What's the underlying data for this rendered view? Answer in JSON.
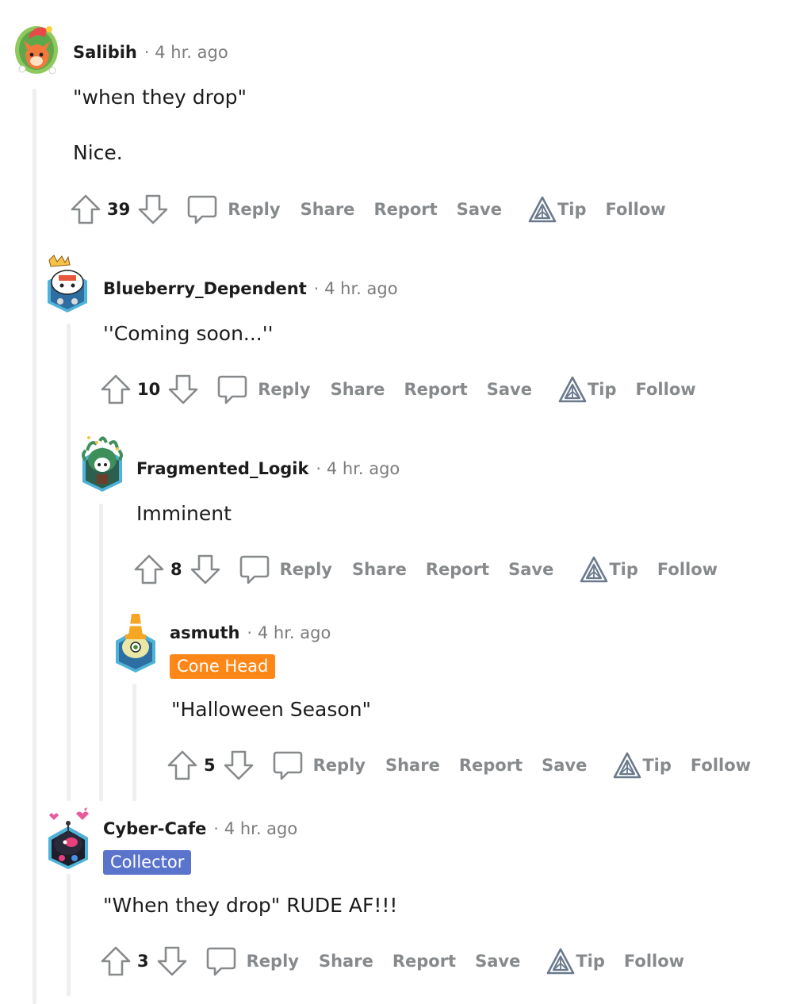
{
  "colors": {
    "thread_line": "#edeff1",
    "meta_gray": "#7c7c7c",
    "action_gray": "#878a8c",
    "cone_head_flair": "#ff8717",
    "collector_flair": "#5a74cc"
  },
  "icons": {
    "upvote": "arrow-up-outline-icon",
    "downvote": "arrow-down-outline-icon",
    "reply": "speech-bubble-icon",
    "tip": "triangle-tip-icon"
  },
  "comments": [
    {
      "username": "Salibih",
      "separator": "·",
      "time": "4 hr. ago",
      "flair": "",
      "body": [
        "\"when they drop\"",
        "Nice."
      ],
      "score": "39",
      "actions": {
        "reply": "Reply",
        "share": "Share",
        "report": "Report",
        "save": "Save",
        "tip": "Tip",
        "follow": "Follow"
      }
    },
    {
      "username": "Blueberry_Dependent",
      "separator": "·",
      "time": "4 hr. ago",
      "flair": "",
      "body": [
        "''Coming soon...''"
      ],
      "score": "10",
      "actions": {
        "reply": "Reply",
        "share": "Share",
        "report": "Report",
        "save": "Save",
        "tip": "Tip",
        "follow": "Follow"
      }
    },
    {
      "username": "Fragmented_Logik",
      "separator": "·",
      "time": "4 hr. ago",
      "flair": "",
      "body": [
        "Imminent"
      ],
      "score": "8",
      "actions": {
        "reply": "Reply",
        "share": "Share",
        "report": "Report",
        "save": "Save",
        "tip": "Tip",
        "follow": "Follow"
      }
    },
    {
      "username": "asmuth",
      "separator": "·",
      "time": "4 hr. ago",
      "flair": "Cone Head",
      "body": [
        "\"Halloween Season\""
      ],
      "score": "5",
      "actions": {
        "reply": "Reply",
        "share": "Share",
        "report": "Report",
        "save": "Save",
        "tip": "Tip",
        "follow": "Follow"
      }
    },
    {
      "username": "Cyber-Cafe",
      "separator": "·",
      "time": "4 hr. ago",
      "flair": "Collector",
      "body": [
        "\"When they drop\" RUDE AF!!!"
      ],
      "score": "3",
      "actions": {
        "reply": "Reply",
        "share": "Share",
        "report": "Report",
        "save": "Save",
        "tip": "Tip",
        "follow": "Follow"
      }
    }
  ]
}
